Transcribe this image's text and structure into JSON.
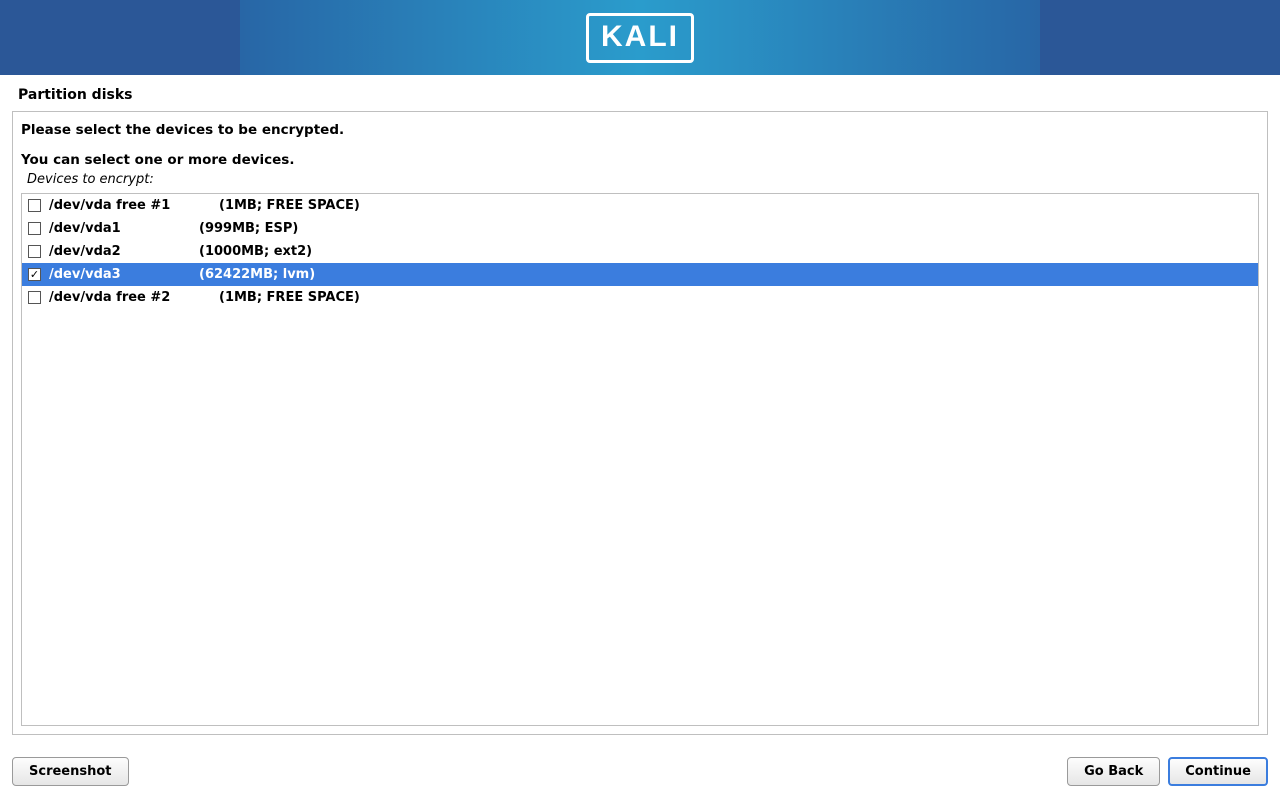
{
  "brand": "KALI",
  "page_title": "Partition disks",
  "instructions": {
    "line1": "Please select the devices to be encrypted.",
    "line2": "You can select one or more devices.",
    "list_label": "Devices to encrypt:"
  },
  "devices": [
    {
      "name": "/dev/vda free #1",
      "info": "(1MB; FREE SPACE)",
      "checked": false,
      "selected": false,
      "wide": true
    },
    {
      "name": "/dev/vda1",
      "info": "(999MB; ESP)",
      "checked": false,
      "selected": false,
      "wide": false
    },
    {
      "name": "/dev/vda2",
      "info": "(1000MB; ext2)",
      "checked": false,
      "selected": false,
      "wide": false
    },
    {
      "name": "/dev/vda3",
      "info": "(62422MB; lvm)",
      "checked": true,
      "selected": true,
      "wide": false
    },
    {
      "name": "/dev/vda free #2",
      "info": "(1MB; FREE SPACE)",
      "checked": false,
      "selected": false,
      "wide": true
    }
  ],
  "buttons": {
    "screenshot": "Screenshot",
    "go_back": "Go Back",
    "continue": "Continue"
  }
}
